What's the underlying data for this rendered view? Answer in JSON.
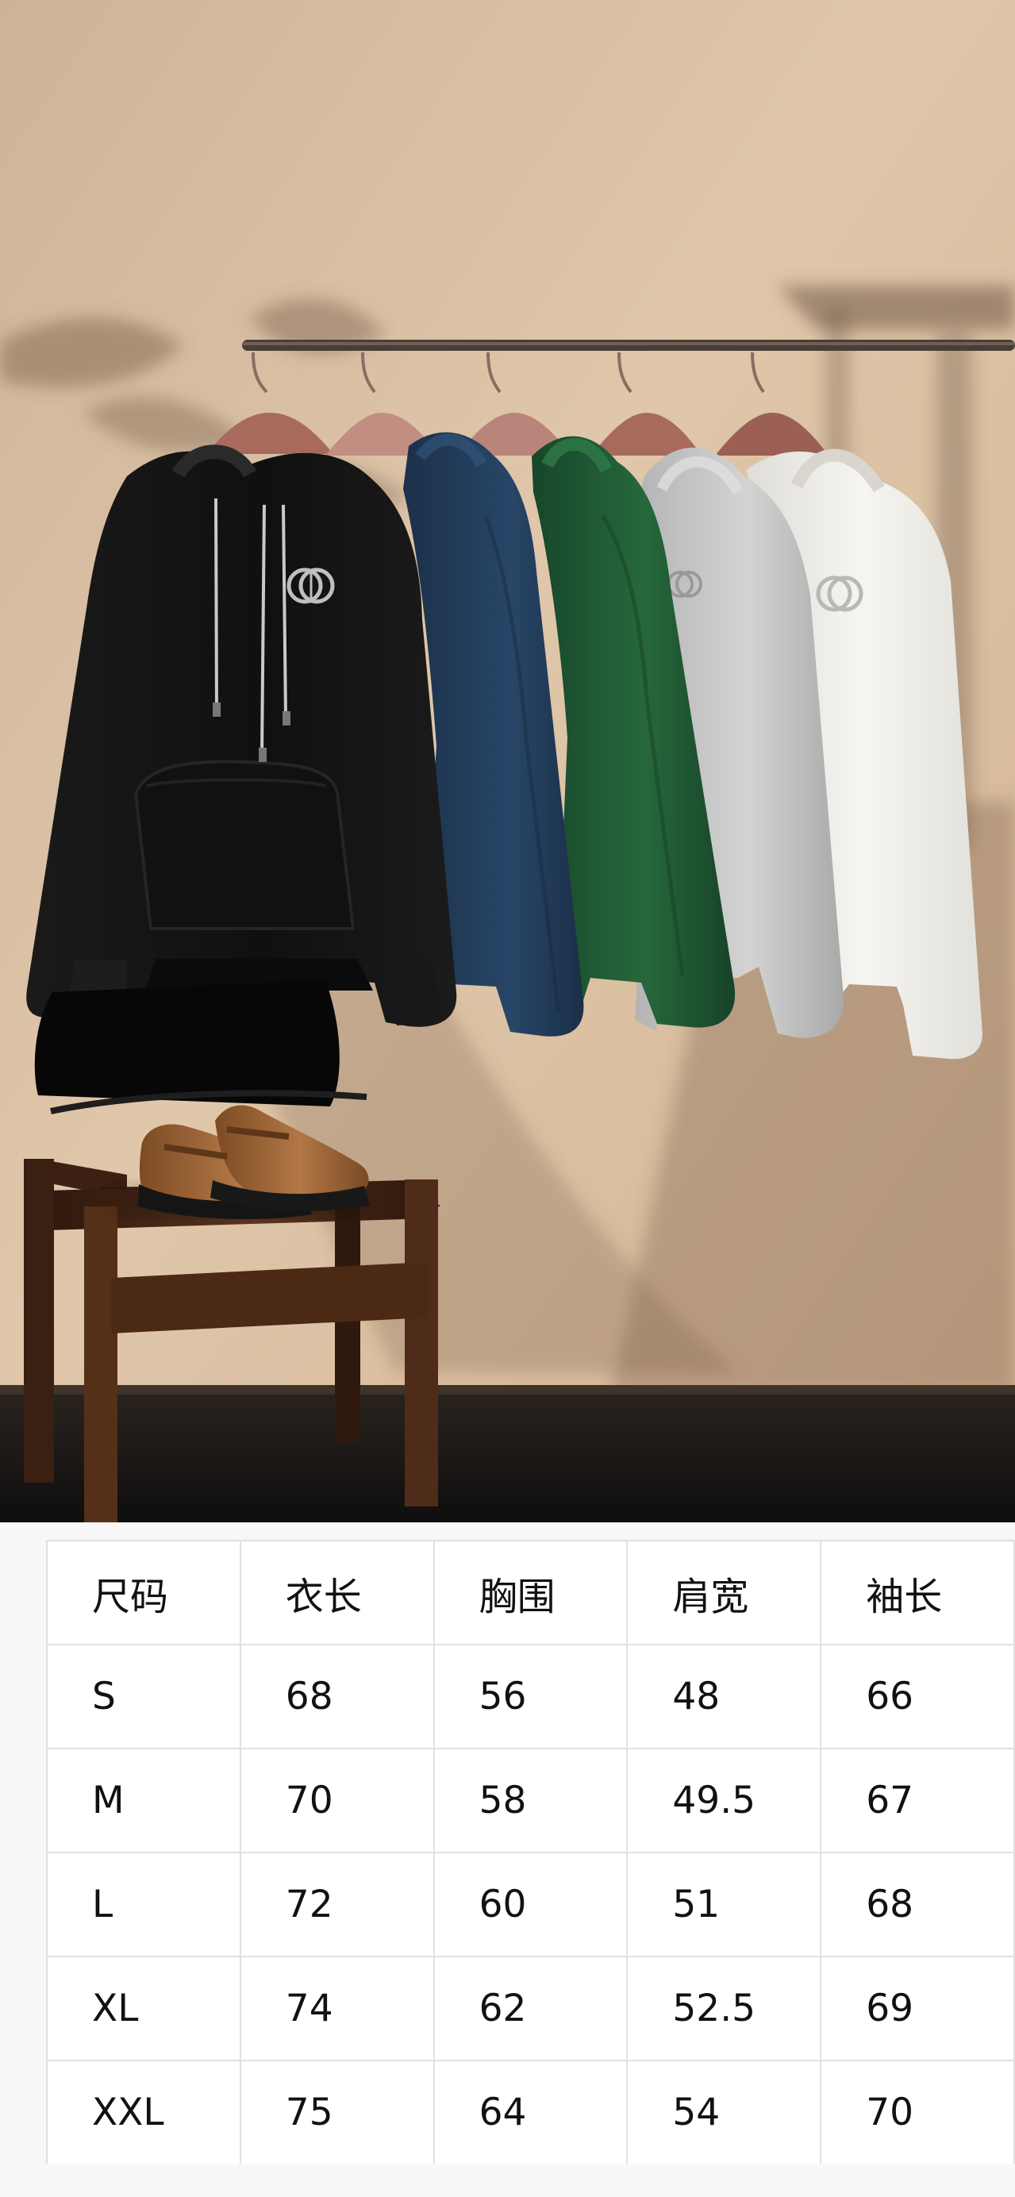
{
  "photo": {
    "alt": "",
    "colors": {
      "wall": "#d6b99d",
      "floor": "#151515",
      "rail": "#4a3d35",
      "hanger": "#a96a5e",
      "black": "#141414",
      "navy": "#223b56",
      "green": "#1f5a32",
      "gray": "#bdbdbd",
      "white": "#f0efea",
      "chair": "#4b2a18",
      "loafer": "#9c6538"
    }
  },
  "size_table": {
    "headers": [
      "尺码",
      "衣长",
      "胸围",
      "肩宽",
      "袖长"
    ],
    "rows": [
      [
        "S",
        "68",
        "56",
        "48",
        "66"
      ],
      [
        "M",
        "70",
        "58",
        "49.5",
        "67"
      ],
      [
        "L",
        "72",
        "60",
        "51",
        "68"
      ],
      [
        "XL",
        "74",
        "62",
        "52.5",
        "69"
      ],
      [
        "XXL",
        "75",
        "64",
        "54",
        "70"
      ]
    ]
  }
}
